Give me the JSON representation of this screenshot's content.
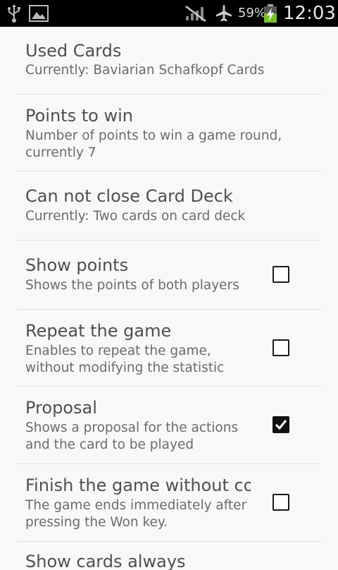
{
  "status_bar": {
    "battery_percent": "59%",
    "time": "12:03",
    "icons": [
      "usb-icon",
      "image-icon",
      "no-signal-icon",
      "airplane-icon",
      "battery-charging-icon"
    ]
  },
  "preferences": [
    {
      "title": "Used Cards",
      "summary": "Currently: Baviarian Schafkopf Cards",
      "checkbox": null
    },
    {
      "title": "Points to win",
      "summary": "Number of points to win a game round, currently 7",
      "checkbox": null
    },
    {
      "title": "Can not close Card Deck",
      "summary": "Currently: Two cards on card deck",
      "checkbox": null
    },
    {
      "title": "Show points",
      "summary": "Shows the points of both players",
      "checkbox": false
    },
    {
      "title": "Repeat the game",
      "summary": "Enables to repeat the game, without modifying the statistic",
      "checkbox": false
    },
    {
      "title": "Proposal",
      "summary": "Shows a proposal for the actions and the card to be played",
      "checkbox": true
    },
    {
      "title": "Finish the game without co",
      "summary": "The game ends immediately after pressing the Won key.",
      "checkbox": false
    },
    {
      "title": "Show cards always",
      "summary": "",
      "checkbox": null
    }
  ]
}
